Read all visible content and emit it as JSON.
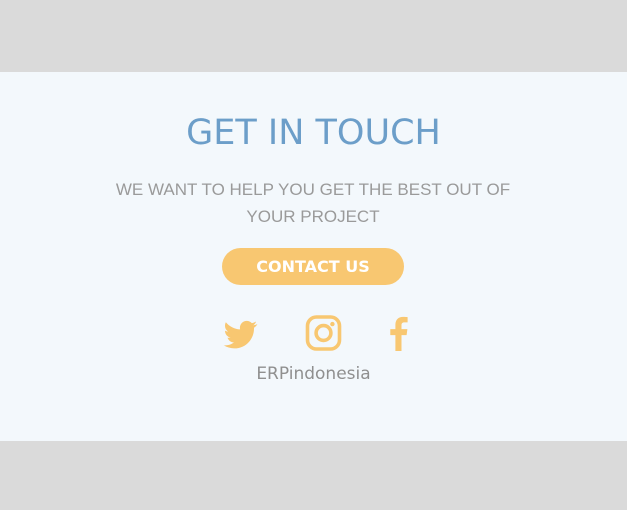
{
  "section": {
    "title": "GET IN TOUCH",
    "subtitle": "WE WANT TO HELP YOU GET THE BEST OUT OF YOUR PROJECT",
    "contact_button": "CONTACT US",
    "handle": "ERPindonesia"
  },
  "social": {
    "icons": [
      "twitter-icon",
      "instagram-icon",
      "facebook-icon"
    ]
  },
  "colors": {
    "page_background": "#dadada",
    "panel_background": "#f3f8fc",
    "title": "#6c9ec9",
    "accent": "#f8c771",
    "muted_text": "#9a9a9a"
  }
}
